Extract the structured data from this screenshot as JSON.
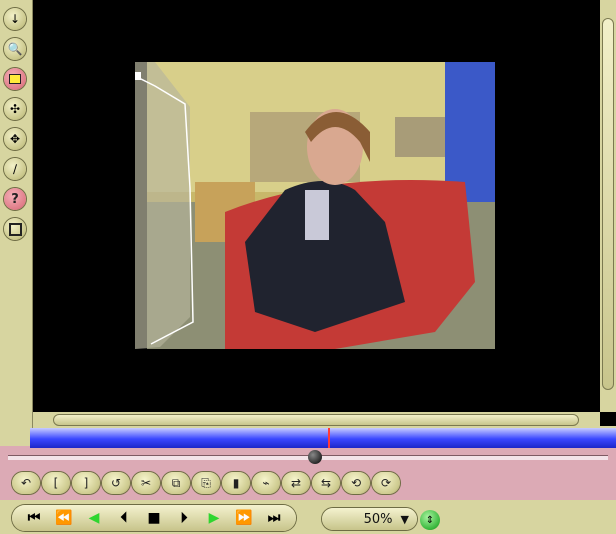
{
  "tools": [
    {
      "name": "pointer-tool-icon"
    },
    {
      "name": "zoom-tool-icon"
    },
    {
      "name": "highlight-tool-icon"
    },
    {
      "name": "move-tool-icon"
    },
    {
      "name": "transform-tool-icon"
    },
    {
      "name": "pen-tool-icon"
    },
    {
      "name": "help-tool-icon",
      "glyph": "?"
    },
    {
      "name": "frame-tool-icon"
    }
  ],
  "transport": {
    "glyphs": [
      "⏮",
      "⏪",
      "◀",
      "⏴",
      "■",
      "⏵",
      "▶",
      "⏩",
      "⏭"
    ]
  },
  "zoom": {
    "value": "50%",
    "arrow": "▼"
  },
  "colors": {
    "panel": "#d7d5a0",
    "pink": "#dcaab5",
    "timeline": "#3a47ff",
    "green": "#2fd62f"
  }
}
